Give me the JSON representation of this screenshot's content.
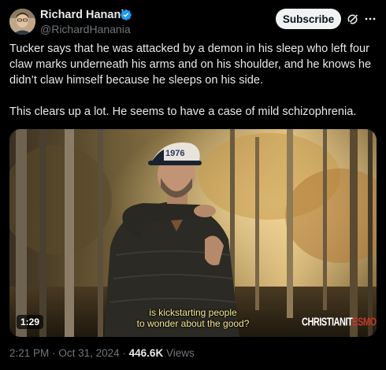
{
  "author": {
    "name": "Richard Hanania",
    "handle": "@RichardHanania",
    "avatar_icon": "avatar-portrait",
    "verified_icon": "verified-badge-icon",
    "verified_color": "#1d9bf0"
  },
  "header": {
    "subscribe_label": "Subscribe",
    "grok_icon": "grok-icon",
    "more_icon": "more-icon"
  },
  "tweet": {
    "paragraph1": "Tucker says that he was attacked by a demon in his sleep who left four claw marks underneath his arms and on his shoulder, and he knows he didn’t claw himself because he sleeps on his side.",
    "paragraph2": "This clears up a lot. He seems to have a case of mild schizophrenia."
  },
  "video": {
    "caption_line1": "is kickstarting people",
    "caption_line2": "to wonder about the good?",
    "duration": "1:29",
    "watermark_part1": "CHRISTIANIT",
    "watermark_part2": "ESMOVIE.COM",
    "hat_text": "1976"
  },
  "meta": {
    "time": "2:21 PM",
    "separator": "·",
    "date": "Oct 31, 2024",
    "views_count": "446.6K",
    "views_label": "Views"
  },
  "colors": {
    "background": "#000000",
    "text_primary": "#e7e9ea",
    "text_secondary": "#71767b",
    "button_bg": "#eff3f4",
    "caption": "#f6e58d"
  }
}
